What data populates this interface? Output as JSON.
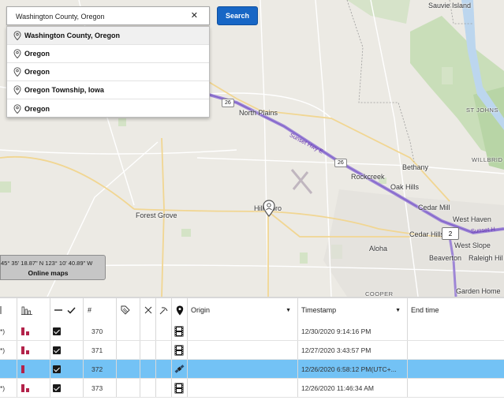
{
  "search": {
    "value": "Washington County, Oregon",
    "clear_symbol": "✕",
    "button_label": "Search",
    "suggestions": [
      {
        "label": "Washington County, Oregon"
      },
      {
        "label": "Oregon"
      },
      {
        "label": "Oregon"
      },
      {
        "label": "Oregon Township, Iowa"
      },
      {
        "label": "Oregon"
      }
    ]
  },
  "map": {
    "places": {
      "sauvie_island": "Sauvie Island",
      "north_plains": "North Plains",
      "st_johns": "ST JOHNS",
      "willbridge": "WILLBRID",
      "bethany": "Bethany",
      "rockcreek": "Rockcreek",
      "oak_hills": "Oak Hills",
      "cedar_mill": "Cedar Mill",
      "west_haven": "West Haven",
      "cedar_hills": "Cedar Hills",
      "west_slope": "West Slope",
      "forest_grove": "Forest Grove",
      "hillsboro": "Hillsboro",
      "aloha": "Aloha",
      "beaverton": "Beaverton",
      "raleigh_hills": "Raleigh Hil",
      "garden_home": "Garden Home",
      "cooper": "COOPER"
    },
    "highway_label": "Sunset Hwy E",
    "highway_label_2": "Sunset H",
    "route_26_a": "26",
    "route_26_b": "26",
    "cluster_count": "2",
    "coordinates": "45° 35' 18.87\" N 123° 10' 40.89\" W",
    "online_maps_label": "Online maps"
  },
  "grid": {
    "headers": {
      "number": "#",
      "origin": "Origin",
      "timestamp": "Timestamp",
      "end_time": "End time"
    },
    "rows": [
      {
        "prefix": "*)",
        "id": "370",
        "timestamp": "12/30/2020 9:14:16 PM",
        "type": "film",
        "selected": false
      },
      {
        "prefix": "*)",
        "id": "371",
        "timestamp": "12/27/2020 3:43:57 PM",
        "type": "film",
        "selected": false
      },
      {
        "prefix": "",
        "id": "372",
        "timestamp": "12/26/2020 6:58:12 PM(UTC+...",
        "type": "satellite",
        "selected": true
      },
      {
        "prefix": "*)",
        "id": "373",
        "timestamp": "12/26/2020 11:46:34 AM",
        "type": "film",
        "selected": false
      }
    ]
  }
}
